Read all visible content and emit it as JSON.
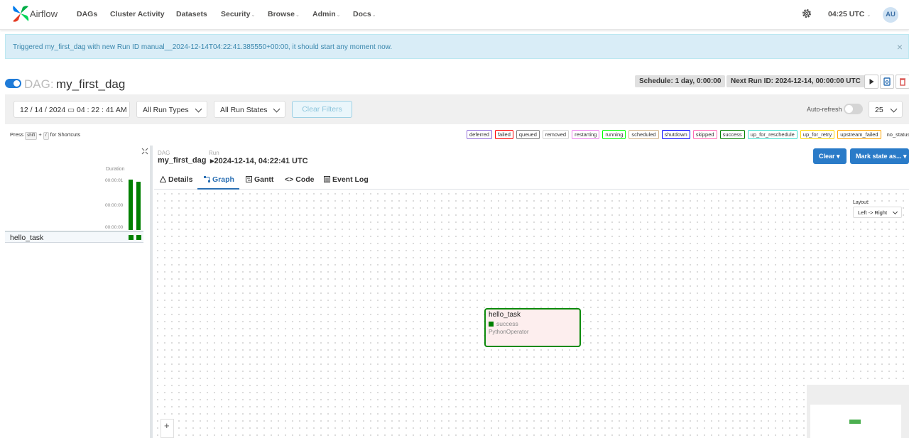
{
  "nav": {
    "brand": "Airflow",
    "items": [
      {
        "label": "DAGs",
        "caret": ""
      },
      {
        "label": "Cluster Activity",
        "caret": ""
      },
      {
        "label": "Datasets",
        "caret": ""
      },
      {
        "label": "Security",
        "caret": "⌄"
      },
      {
        "label": "Browse",
        "caret": "⌄"
      },
      {
        "label": "Admin",
        "caret": "⌄"
      },
      {
        "label": "Docs",
        "caret": "⌄"
      }
    ],
    "time": "04:25 UTC",
    "time_caret": "⌄",
    "avatar": "AU"
  },
  "alert": {
    "text": "Triggered my_first_dag with new Run ID manual__2024-12-14T04:22:41.385550+00:00, it should start any moment now.",
    "close": "×"
  },
  "dag": {
    "prefix": "DAG:",
    "name": "my_first_dag",
    "schedule": "Schedule: 1 day, 0:00:00",
    "next_run": "Next Run ID: 2024-12-14, 00:00:00 UTC"
  },
  "filters": {
    "datetime": "12 / 14 / 2024 ▭  04 : 22 : 41   AM",
    "run_types": "All Run Types",
    "run_states": "All Run States",
    "clear": "Clear Filters",
    "auto_refresh": "Auto-refresh",
    "page_size": "25"
  },
  "shortcuts": {
    "press": "Press",
    "key1": "shift",
    "plus": "+",
    "key2": "/",
    "suffix": "for Shortcuts"
  },
  "legend": [
    {
      "label": "deferred",
      "color": "#9370db"
    },
    {
      "label": "failed",
      "color": "#ff0000"
    },
    {
      "label": "queued",
      "color": "#808080"
    },
    {
      "label": "removed",
      "color": "#d3d3d3"
    },
    {
      "label": "restarting",
      "color": "#ee82ee"
    },
    {
      "label": "running",
      "color": "#00ff00"
    },
    {
      "label": "scheduled",
      "color": "#d2b48c"
    },
    {
      "label": "shutdown",
      "color": "#0000ff"
    },
    {
      "label": "skipped",
      "color": "#ff69b4"
    },
    {
      "label": "success",
      "color": "#008000"
    },
    {
      "label": "up_for_reschedule",
      "color": "#40e0d0"
    },
    {
      "label": "up_for_retry",
      "color": "#ffd700"
    },
    {
      "label": "upstream_failed",
      "color": "#ffa500"
    },
    {
      "label": "no_status",
      "color": ""
    }
  ],
  "grid": {
    "duration_label": "Duration",
    "ticks": [
      "00:00:01",
      "00:00:00",
      "00:00:00"
    ],
    "task": "hello_task"
  },
  "run": {
    "dag_label": "DAG",
    "dag_value": "my_first_dag",
    "run_label": "Run",
    "run_value": "2024-12-14, 04:22:41 UTC",
    "clear_btn": "Clear ▾",
    "mark_btn": "Mark state as... ▾"
  },
  "tabs": [
    "Details",
    "Graph",
    "Gantt",
    "Code",
    "Event Log"
  ],
  "graph": {
    "layout_label": "Layout:",
    "layout_value": "Left -> Right",
    "node": {
      "name": "hello_task",
      "status": "success",
      "operator": "PythonOperator"
    },
    "zoom_in": "+"
  }
}
